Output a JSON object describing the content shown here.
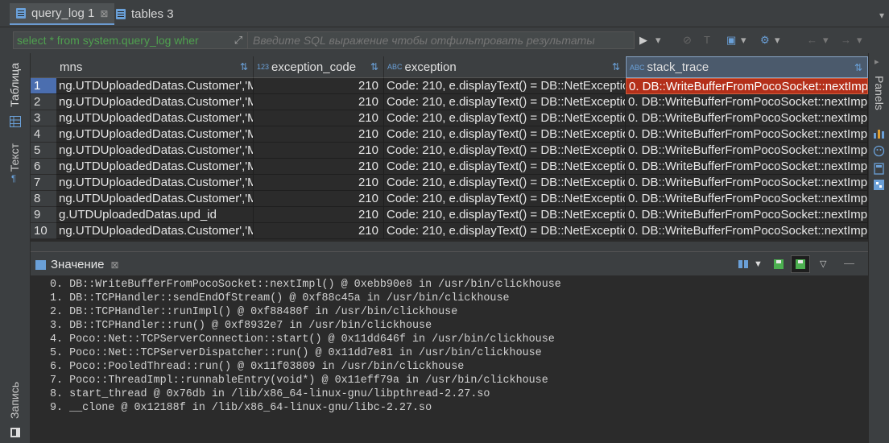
{
  "tabs": [
    {
      "label": "query_log 1",
      "close": "⊠"
    },
    {
      "label": "tables 3"
    }
  ],
  "filter": {
    "query": "select * from system.query_log wher",
    "placeholder": "Введите SQL выражение чтобы отфильтровать результаты"
  },
  "left_tabs": {
    "table": "Таблица",
    "text": "Текст",
    "record": "Запись"
  },
  "right_tabs": {
    "panels": "Panels"
  },
  "grid": {
    "columns": [
      {
        "label": "mns",
        "type": ""
      },
      {
        "label": "exception_code",
        "type": "123"
      },
      {
        "label": "exception",
        "type": "ABC"
      },
      {
        "label": "stack_trace",
        "type": "ABC"
      }
    ],
    "rows": [
      {
        "n": "1",
        "c1": "ng.UTDUploadedDatas.Customer','M",
        "c2": "210",
        "c3": "Code: 210, e.displayText() = DB::NetExceptio",
        "c4": "0. DB::WriteBufferFromPocoSocket::nextImp"
      },
      {
        "n": "2",
        "c1": "ng.UTDUploadedDatas.Customer','M",
        "c2": "210",
        "c3": "Code: 210, e.displayText() = DB::NetExceptio",
        "c4": "0. DB::WriteBufferFromPocoSocket::nextImp"
      },
      {
        "n": "3",
        "c1": "ng.UTDUploadedDatas.Customer','M",
        "c2": "210",
        "c3": "Code: 210, e.displayText() = DB::NetExceptio",
        "c4": "0. DB::WriteBufferFromPocoSocket::nextImp"
      },
      {
        "n": "4",
        "c1": "ng.UTDUploadedDatas.Customer','M",
        "c2": "210",
        "c3": "Code: 210, e.displayText() = DB::NetExceptio",
        "c4": "0. DB::WriteBufferFromPocoSocket::nextImp"
      },
      {
        "n": "5",
        "c1": "ng.UTDUploadedDatas.Customer','M",
        "c2": "210",
        "c3": "Code: 210, e.displayText() = DB::NetExceptio",
        "c4": "0. DB::WriteBufferFromPocoSocket::nextImp"
      },
      {
        "n": "6",
        "c1": "ng.UTDUploadedDatas.Customer','M",
        "c2": "210",
        "c3": "Code: 210, e.displayText() = DB::NetExceptio",
        "c4": "0. DB::WriteBufferFromPocoSocket::nextImp"
      },
      {
        "n": "7",
        "c1": "ng.UTDUploadedDatas.Customer','M",
        "c2": "210",
        "c3": "Code: 210, e.displayText() = DB::NetExceptio",
        "c4": "0. DB::WriteBufferFromPocoSocket::nextImp"
      },
      {
        "n": "8",
        "c1": "ng.UTDUploadedDatas.Customer','M",
        "c2": "210",
        "c3": "Code: 210, e.displayText() = DB::NetExceptio",
        "c4": "0. DB::WriteBufferFromPocoSocket::nextImp"
      },
      {
        "n": "9",
        "c1": "g.UTDUploadedDatas.upd_id",
        "c2": "210",
        "c3": "Code: 210, e.displayText() = DB::NetExceptio",
        "c4": "0. DB::WriteBufferFromPocoSocket::nextImp"
      },
      {
        "n": "10",
        "c1": "ng.UTDUploadedDatas.Customer','M",
        "c2": "210",
        "c3": "Code: 210, e.displayText() = DB::NetExceptio",
        "c4": "0. DB::WriteBufferFromPocoSocket::nextImp"
      }
    ]
  },
  "value_panel": {
    "title": "Значение",
    "close": "⊠",
    "lines": [
      "0. DB::WriteBufferFromPocoSocket::nextImpl() @ 0xebb90e8 in /usr/bin/clickhouse",
      "1. DB::TCPHandler::sendEndOfStream() @ 0xf88c45a in /usr/bin/clickhouse",
      "2. DB::TCPHandler::runImpl() @ 0xf88480f in /usr/bin/clickhouse",
      "3. DB::TCPHandler::run() @ 0xf8932e7 in /usr/bin/clickhouse",
      "4. Poco::Net::TCPServerConnection::start() @ 0x11dd646f in /usr/bin/clickhouse",
      "5. Poco::Net::TCPServerDispatcher::run() @ 0x11dd7e81 in /usr/bin/clickhouse",
      "6. Poco::PooledThread::run() @ 0x11f03809 in /usr/bin/clickhouse",
      "7. Poco::ThreadImpl::runnableEntry(void*) @ 0x11eff79a in /usr/bin/clickhouse",
      "8. start_thread @ 0x76db in /lib/x86_64-linux-gnu/libpthread-2.27.so",
      "9. __clone @ 0x12188f in /lib/x86_64-linux-gnu/libc-2.27.so"
    ]
  },
  "colors": {
    "accent": "#6aa0d8",
    "highlight_cell": "#b4301a",
    "row_selected": "#4b6eaf",
    "query_text": "#4fa04f"
  }
}
